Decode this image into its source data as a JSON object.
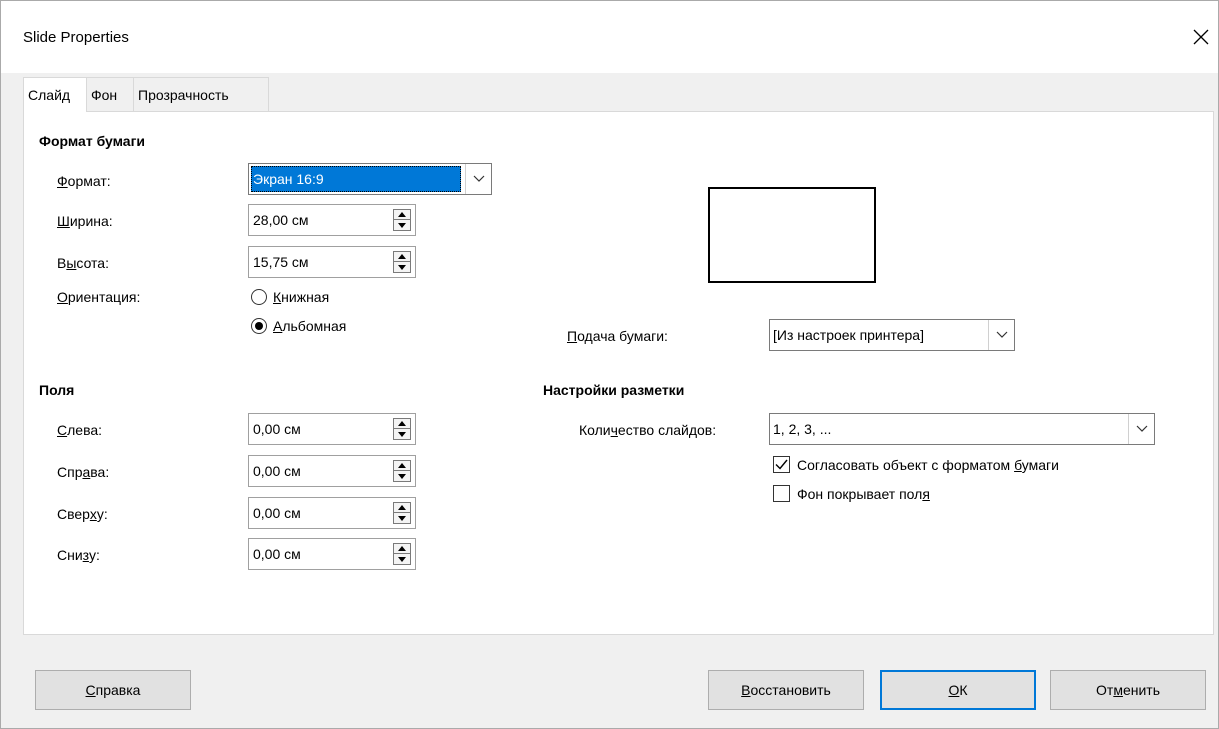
{
  "window": {
    "title": "Slide Properties"
  },
  "tabs": [
    {
      "label": "Слайд"
    },
    {
      "label": "Фон"
    },
    {
      "label": "Прозрачность"
    }
  ],
  "paper_format": {
    "section_title": "Формат бумаги",
    "format": {
      "label_u": "Ф",
      "label_rest": "ормат:",
      "value": "Экран 16:9"
    },
    "width": {
      "label_u": "Ш",
      "label_rest": "ирина:",
      "value": "28,00 см"
    },
    "height": {
      "label_pre": "В",
      "label_u": "ы",
      "label_rest": "сота:",
      "value": "15,75 см"
    },
    "orientation": {
      "label_u": "О",
      "label_rest": "риентация:",
      "portrait": {
        "label_u": "К",
        "label_rest": "нижная",
        "checked": false
      },
      "landscape": {
        "label_u": "А",
        "label_rest": "льбомная",
        "checked": true
      }
    },
    "paper_tray": {
      "label_u": "П",
      "label_rest": "одача бумаги:",
      "value": "[Из настроек принтера]"
    }
  },
  "margins": {
    "section_title": "Поля",
    "left": {
      "label_u": "С",
      "label_rest": "лева:",
      "value": "0,00 см"
    },
    "right": {
      "label_pre": "Спр",
      "label_u": "а",
      "label_rest": "ва:",
      "value": "0,00 см"
    },
    "top": {
      "label_pre": "Свер",
      "label_u": "х",
      "label_rest": "у:",
      "value": "0,00 см"
    },
    "bottom": {
      "label_pre": "Сни",
      "label_u": "з",
      "label_rest": "у:",
      "value": "0,00 см"
    }
  },
  "layout_settings": {
    "section_title": "Настройки разметки",
    "slide_count": {
      "label_pre": "Коли",
      "label_u": "ч",
      "label_rest": "ество слайдов:",
      "value": "1, 2, 3, ..."
    },
    "fit_object": {
      "label_pre": "Согласовать объект с форматом ",
      "label_u": "б",
      "label_rest": "умаги",
      "checked": true
    },
    "bg_covers": {
      "label_pre": "Фон покрывает пол",
      "label_u": "я",
      "label_rest": "",
      "checked": false
    }
  },
  "buttons": {
    "help": {
      "label_u": "С",
      "label_rest": "правка"
    },
    "reset": {
      "label_u": "В",
      "label_rest": "осстановить"
    },
    "ok": {
      "label_u": "О",
      "label_rest": "К"
    },
    "cancel": {
      "label_pre": "От",
      "label_u": "м",
      "label_rest": "енить"
    }
  },
  "icons": {
    "close": "close-icon",
    "dropdown": "chevron-down-icon",
    "spin_up": "triangle-up-icon",
    "spin_down": "triangle-down-icon",
    "checkmark": "checkmark-icon"
  },
  "colors": {
    "accent": "#0078d7",
    "dialog_bg": "#f0f0f0",
    "panel_bg": "#ffffff"
  }
}
